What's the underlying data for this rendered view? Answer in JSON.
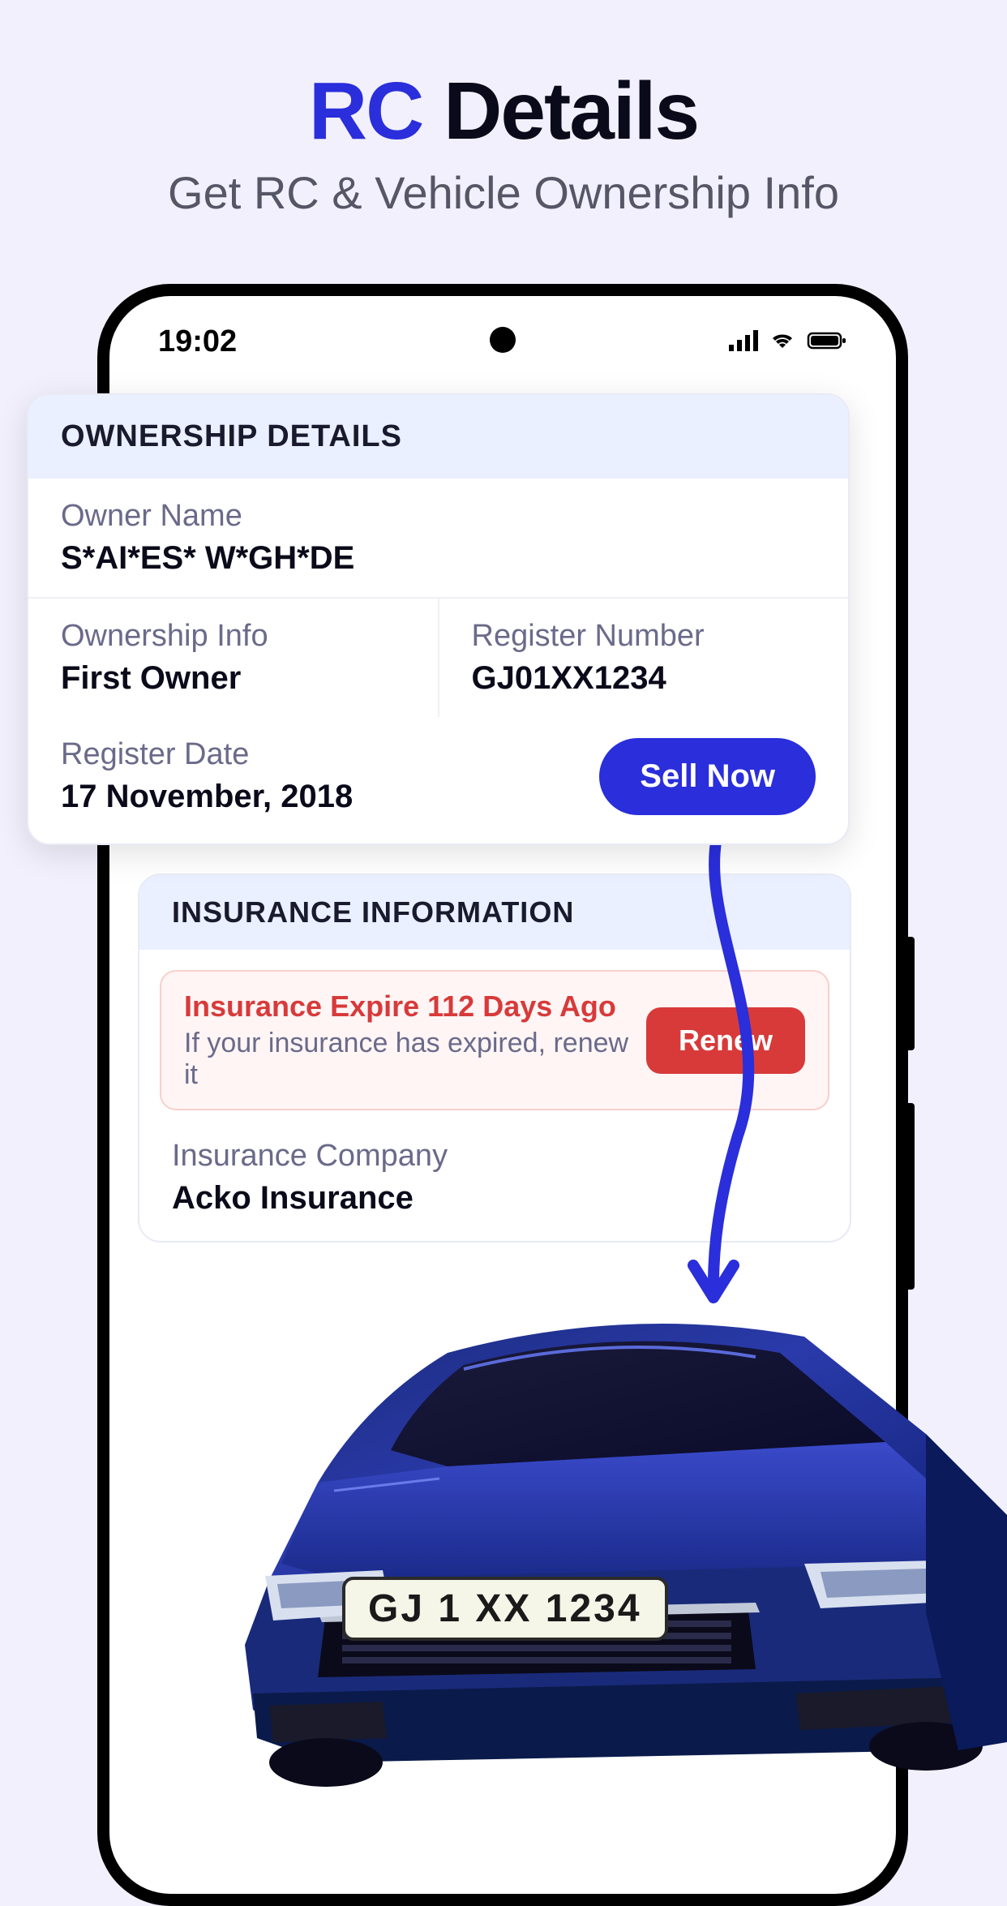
{
  "header": {
    "title_rc": "RC",
    "title_details": " Details",
    "subtitle": "Get RC & Vehicle Ownership Info"
  },
  "status": {
    "time": "19:02"
  },
  "ownership": {
    "header": "OWNERSHIP DETAILS",
    "owner_name_label": "Owner Name",
    "owner_name_value": "S*AI*ES* W*GH*DE",
    "ownership_info_label": "Ownership Info",
    "ownership_info_value": "First Owner",
    "register_number_label": "Register Number",
    "register_number_value": "GJ01XX1234",
    "register_date_label": "Register Date",
    "register_date_value": "17 November, 2018",
    "sell_now_label": "Sell Now"
  },
  "insurance": {
    "header": "INSURANCE INFORMATION",
    "expire_title": "Insurance Expire 112 Days Ago",
    "expire_subtitle": "If your insurance has expired, renew it",
    "renew_label": "Renew",
    "company_label": "Insurance Company",
    "company_value": "Acko Insurance"
  },
  "car": {
    "plate": "GJ 1 XX 1234"
  }
}
